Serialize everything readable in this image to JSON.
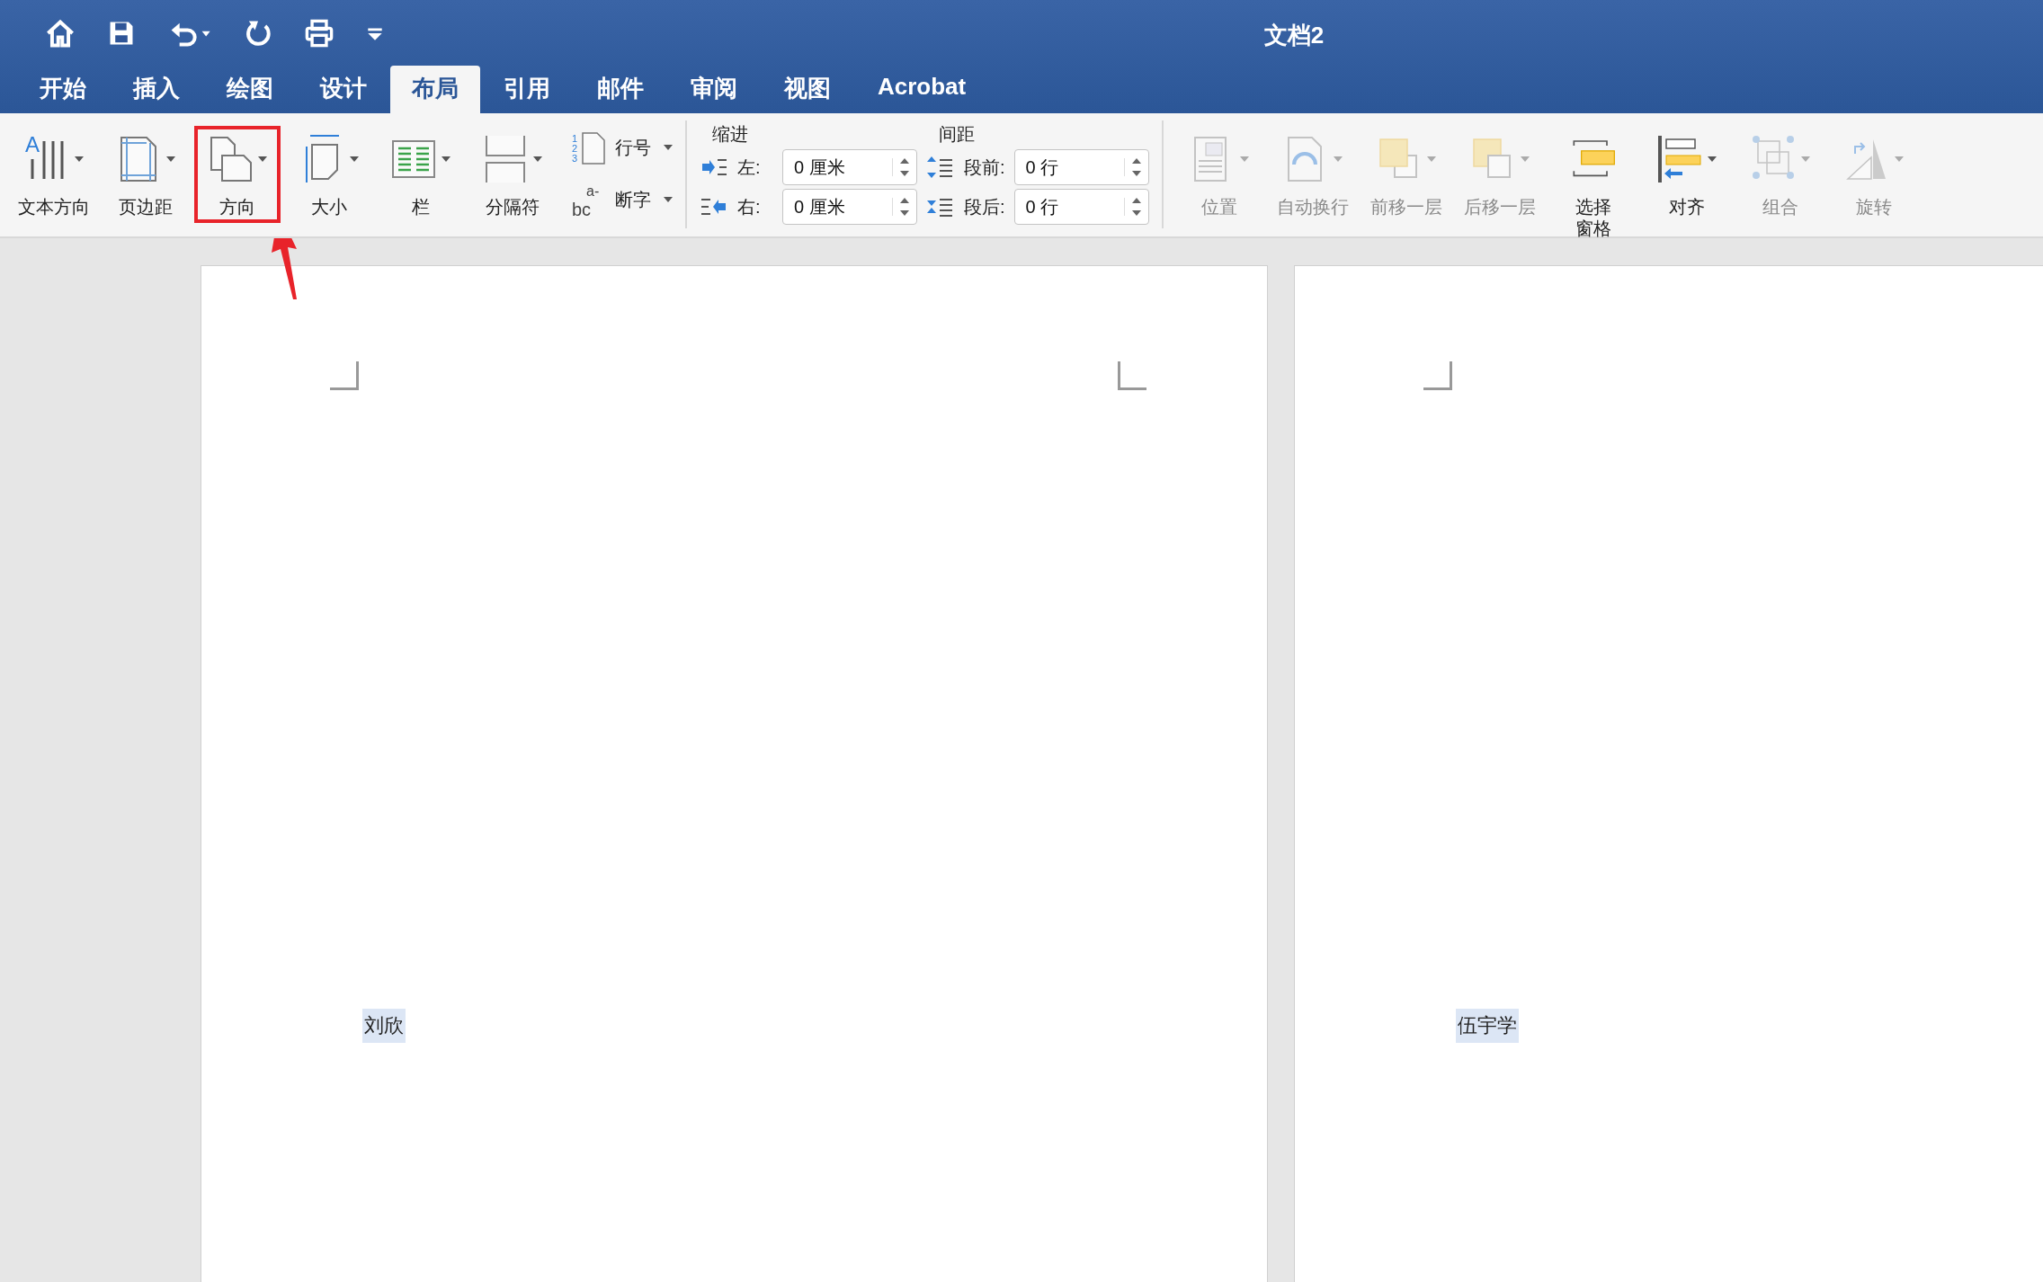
{
  "window": {
    "title": "文档2"
  },
  "tabs": [
    {
      "label": "开始",
      "selected": false
    },
    {
      "label": "插入",
      "selected": false
    },
    {
      "label": "绘图",
      "selected": false
    },
    {
      "label": "设计",
      "selected": false
    },
    {
      "label": "布局",
      "selected": true
    },
    {
      "label": "引用",
      "selected": false
    },
    {
      "label": "邮件",
      "selected": false
    },
    {
      "label": "审阅",
      "selected": false
    },
    {
      "label": "视图",
      "selected": false
    },
    {
      "label": "Acrobat",
      "selected": false
    }
  ],
  "ribbon": {
    "page_setup": [
      {
        "label": "文本方向",
        "kind": "text-direction",
        "highlighted": false,
        "icon_text": [
          "A"
        ]
      },
      {
        "label": "页边距",
        "kind": "margins",
        "highlighted": false
      },
      {
        "label": "方向",
        "kind": "orientation",
        "highlighted": true
      },
      {
        "label": "大小",
        "kind": "size",
        "highlighted": false
      },
      {
        "label": "栏",
        "kind": "columns",
        "highlighted": false
      },
      {
        "label": "分隔符",
        "kind": "breaks",
        "highlighted": false
      }
    ],
    "small_buttons": [
      {
        "label": "行号",
        "kind": "line-numbers",
        "icon_text": [
          "1",
          "2",
          "3"
        ]
      },
      {
        "label": "断字",
        "kind": "hyphenation",
        "icon_text": [
          "a-",
          "bc"
        ]
      }
    ],
    "paragraph": {
      "indent": {
        "title": "缩进",
        "fields": [
          {
            "label": "左:",
            "value": "0 厘米",
            "kind": "left"
          },
          {
            "label": "右:",
            "value": "0 厘米",
            "kind": "right"
          }
        ]
      },
      "spacing": {
        "title": "间距",
        "fields": [
          {
            "label": "段前:",
            "value": "0 行",
            "kind": "before"
          },
          {
            "label": "段后:",
            "value": "0 行",
            "kind": "after"
          }
        ]
      }
    },
    "arrange": [
      {
        "label": "位置",
        "kind": "position",
        "disabled": true
      },
      {
        "label": "自动换行",
        "kind": "wrap",
        "disabled": true
      },
      {
        "label": "前移一层",
        "kind": "forward",
        "disabled": true
      },
      {
        "label": "后移一层",
        "kind": "backward",
        "disabled": true
      },
      {
        "label": "选择窗格",
        "kind": "pane",
        "disabled": false
      },
      {
        "label": "对齐",
        "kind": "align",
        "disabled": false
      },
      {
        "label": "组合",
        "kind": "group",
        "disabled": true
      },
      {
        "label": "旋转",
        "kind": "rotate",
        "disabled": true
      }
    ]
  },
  "pages": [
    {
      "text": "刘欣",
      "highlighted": true
    },
    {
      "text": "伍宇学",
      "highlighted": true
    }
  ]
}
